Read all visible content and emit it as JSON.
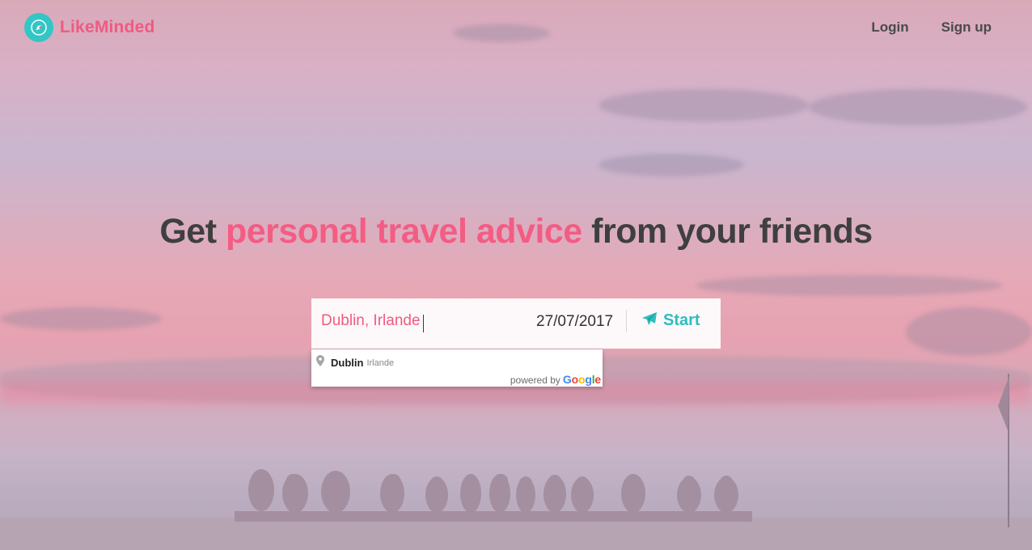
{
  "brand": {
    "name": "LikeMinded",
    "logo_icon": "compass-icon",
    "brand_color": "#f05a82",
    "icon_color": "#33c6c6"
  },
  "nav": {
    "login_label": "Login",
    "signup_label": "Sign up"
  },
  "hero": {
    "title_prefix": "Get ",
    "title_accent": "personal travel advice",
    "title_suffix": " from your friends",
    "accent_color": "#f45c84"
  },
  "search": {
    "destination_value": "Dublin, Irlande",
    "date_value": "27/07/2017",
    "start_label": "Start",
    "start_icon": "paper-plane-icon",
    "start_color": "#2fbdbd"
  },
  "autocomplete": {
    "items": [
      {
        "main": "Dublin",
        "secondary": "Irlande",
        "icon": "map-pin-icon"
      }
    ],
    "powered_by": "powered by",
    "provider": "Google"
  }
}
